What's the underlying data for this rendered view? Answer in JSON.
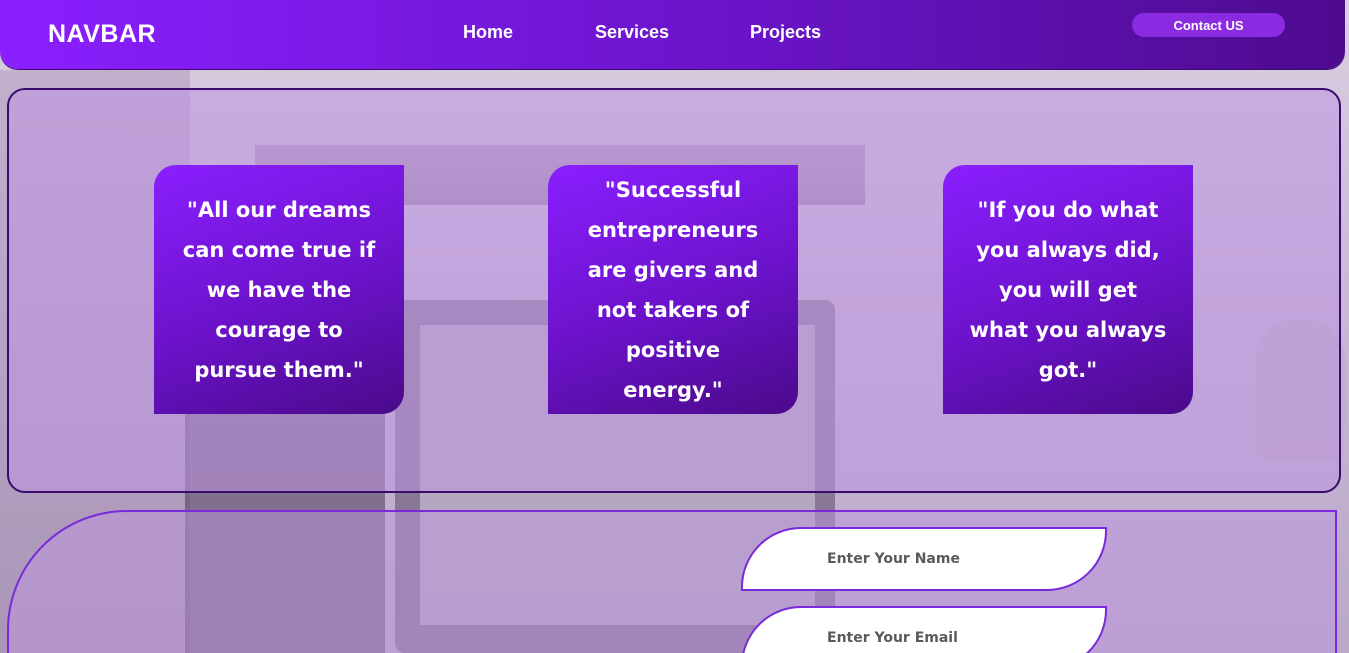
{
  "navbar": {
    "brand": "NAVBAR",
    "links": [
      {
        "label": "Home"
      },
      {
        "label": "Services"
      },
      {
        "label": "Projects"
      }
    ],
    "contact_label": "Contact US"
  },
  "quotes": [
    {
      "text": "\"All our dreams can come true if we have the courage to pursue them.\""
    },
    {
      "text": "\"Successful entrepreneurs are givers and not takers of positive energy.\""
    },
    {
      "text": "\"If you do what you always did, you will get what you always got.\""
    }
  ],
  "form": {
    "name_placeholder": "Enter Your Name",
    "email_placeholder": "Enter Your Email"
  },
  "colors": {
    "primary": "#8a1fff",
    "primary_dark": "#4d0b8f",
    "border": "#7a2ad8"
  }
}
